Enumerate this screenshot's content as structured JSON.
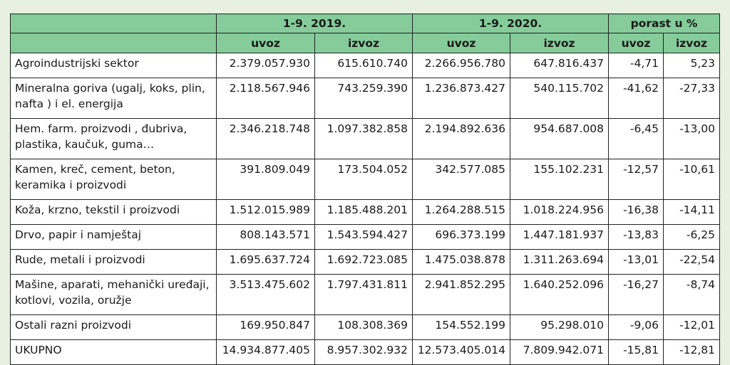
{
  "header": {
    "period_1": "1-9. 2019.",
    "period_2": "1-9. 2020.",
    "growth": "porast u %",
    "import": "uvoz",
    "export": "izvoz"
  },
  "rows": [
    {
      "label": "Agroindustrijski sektor",
      "imp2019": "2.379.057.930",
      "exp2019": "615.610.740",
      "imp2020": "2.266.956.780",
      "exp2020": "647.816.437",
      "gimp": "-4,71",
      "gexp": "5,23"
    },
    {
      "label": "Mineralna goriva (ugalj, koks, plin, nafta ) i el. energija",
      "imp2019": "2.118.567.946",
      "exp2019": "743.259.390",
      "imp2020": "1.236.873.427",
      "exp2020": "540.115.702",
      "gimp": "-41,62",
      "gexp": "-27,33"
    },
    {
      "label": "Hem. farm. proizvodi , đubriva, plastika, kaučuk, guma…",
      "imp2019": "2.346.218.748",
      "exp2019": "1.097.382.858",
      "imp2020": "2.194.892.636",
      "exp2020": "954.687.008",
      "gimp": "-6,45",
      "gexp": "-13,00"
    },
    {
      "label": "Kamen, kreč, cement, beton, keramika i proizvodi",
      "imp2019": "391.809.049",
      "exp2019": "173.504.052",
      "imp2020": "342.577.085",
      "exp2020": "155.102.231",
      "gimp": "-12,57",
      "gexp": "-10,61"
    },
    {
      "label": "Koža, krzno, tekstil i proizvodi",
      "imp2019": "1.512.015.989",
      "exp2019": "1.185.488.201",
      "imp2020": "1.264.288.515",
      "exp2020": "1.018.224.956",
      "gimp": "-16,38",
      "gexp": "-14,11"
    },
    {
      "label": "Drvo, papir i namještaj",
      "imp2019": "808.143.571",
      "exp2019": "1.543.594.427",
      "imp2020": "696.373.199",
      "exp2020": "1.447.181.937",
      "gimp": "-13,83",
      "gexp": "-6,25"
    },
    {
      "label": "Rude, metali i proizvodi",
      "imp2019": "1.695.637.724",
      "exp2019": "1.692.723.085",
      "imp2020": "1.475.038.878",
      "exp2020": "1.311.263.694",
      "gimp": "-13,01",
      "gexp": "-22,54"
    },
    {
      "label": "Mašine, aparati, mehanički uređaji, kotlovi, vozila, oružje",
      "imp2019": "3.513.475.602",
      "exp2019": "1.797.431.811",
      "imp2020": "2.941.852.295",
      "exp2020": "1.640.252.096",
      "gimp": "-16,27",
      "gexp": "-8,74"
    },
    {
      "label": "Ostali razni proizvodi",
      "imp2019": "169.950.847",
      "exp2019": "108.308.369",
      "imp2020": "154.552.199",
      "exp2020": "95.298.010",
      "gimp": "-9,06",
      "gexp": "-12,01"
    },
    {
      "label": "UKUPNO",
      "imp2019": "14.934.877.405",
      "exp2019": "8.957.302.932",
      "imp2020": "12.573.405.014",
      "exp2020": "7.809.942.071",
      "gimp": "-15,81",
      "gexp": "-12,81"
    }
  ]
}
